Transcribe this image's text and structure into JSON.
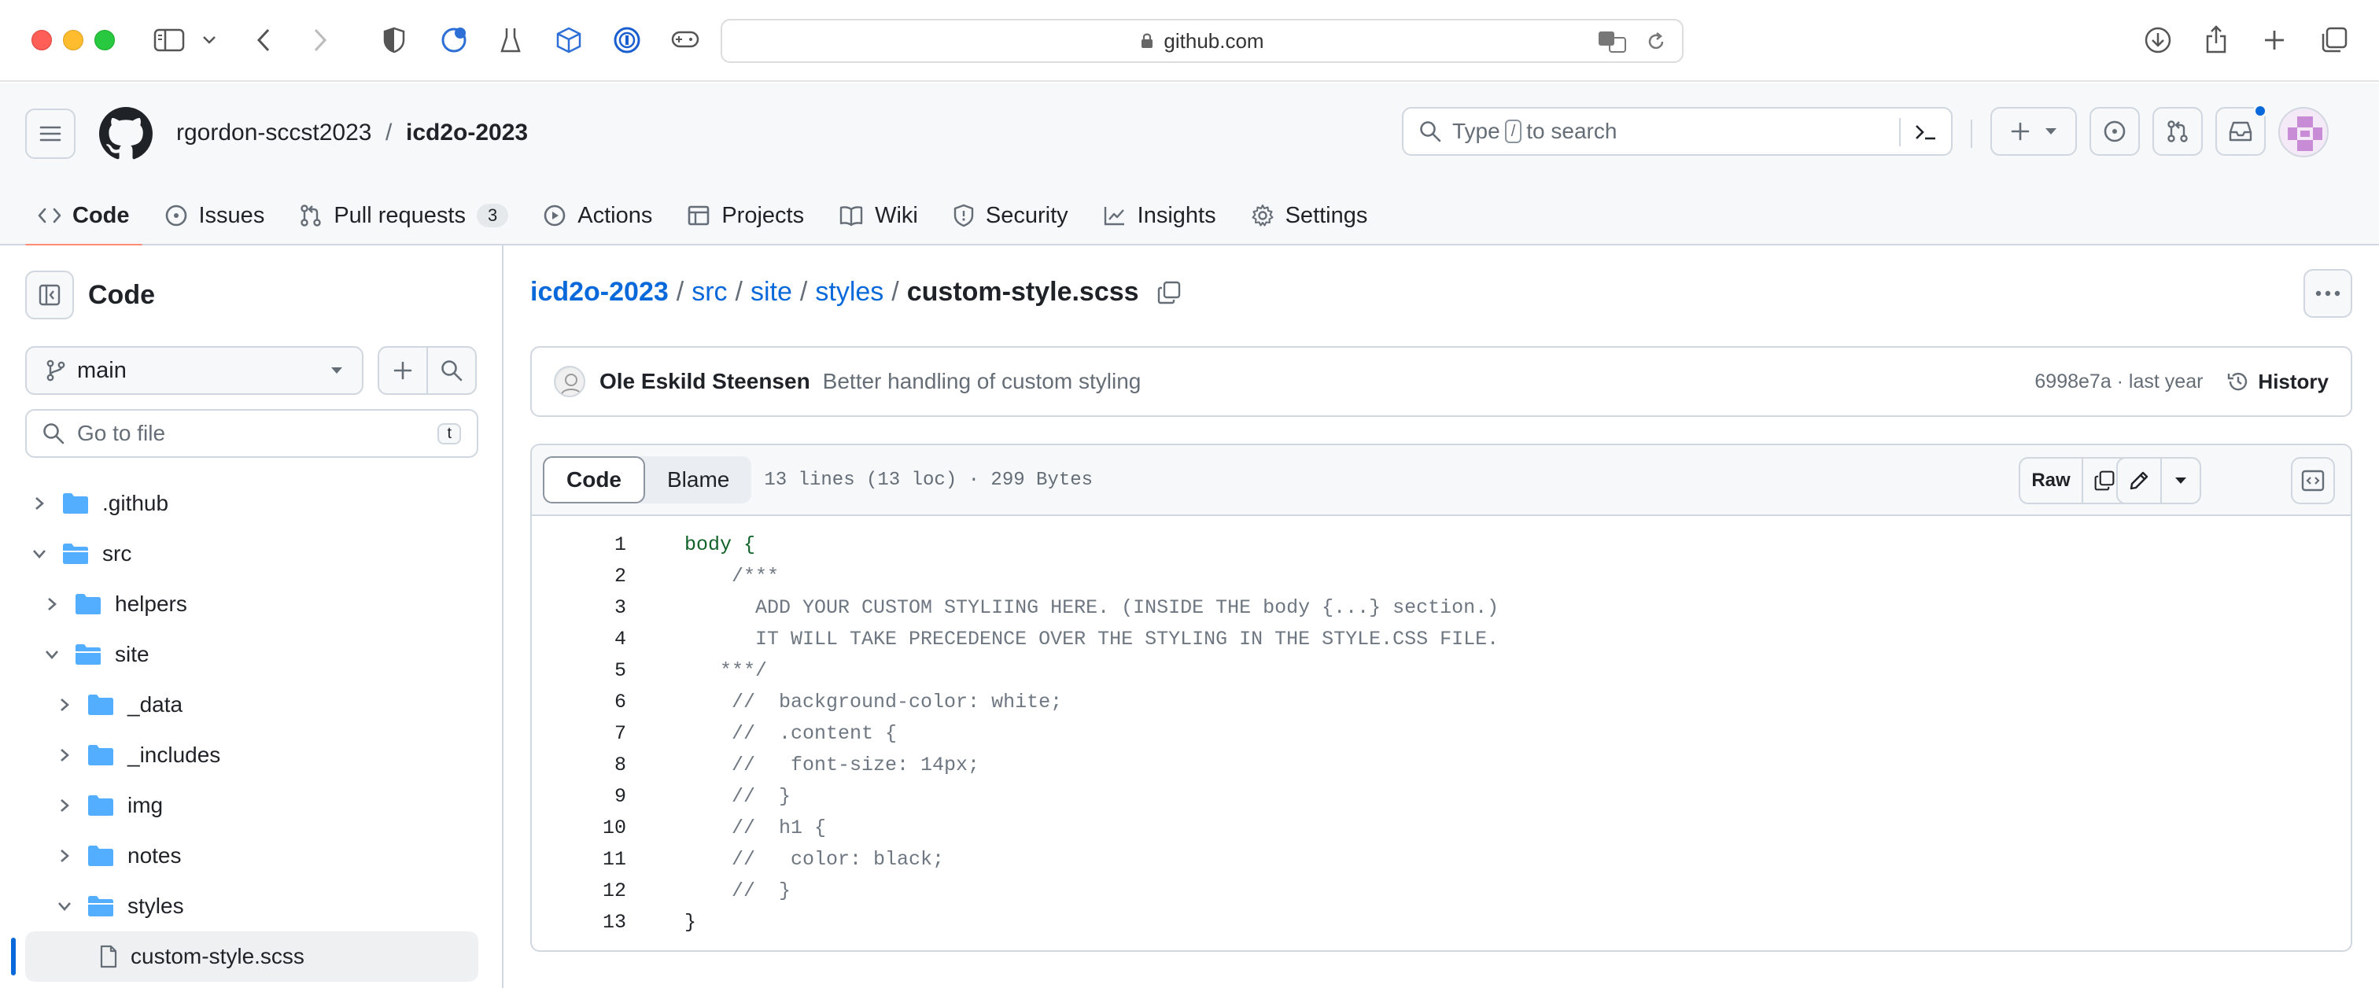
{
  "browser": {
    "url": "github.com"
  },
  "header": {
    "owner": "rgordon-sccst2023",
    "separator": "/",
    "repo": "icd2o-2023",
    "search_prefix": "Type",
    "search_key": "/",
    "search_suffix": "to search"
  },
  "repo_nav": {
    "tabs": [
      {
        "label": "Code",
        "icon": "code-icon",
        "active": true
      },
      {
        "label": "Issues",
        "icon": "issue-icon"
      },
      {
        "label": "Pull requests",
        "icon": "pull-request-icon",
        "count": "3"
      },
      {
        "label": "Actions",
        "icon": "play-icon"
      },
      {
        "label": "Projects",
        "icon": "table-icon"
      },
      {
        "label": "Wiki",
        "icon": "book-icon"
      },
      {
        "label": "Security",
        "icon": "shield-icon"
      },
      {
        "label": "Insights",
        "icon": "graph-icon"
      },
      {
        "label": "Settings",
        "icon": "gear-icon"
      }
    ]
  },
  "sidebar": {
    "title": "Code",
    "branch": "main",
    "goto_placeholder": "Go to file",
    "goto_key": "t",
    "tree": [
      {
        "name": ".github",
        "expanded": false,
        "depth": 0
      },
      {
        "name": "src",
        "expanded": true,
        "depth": 0
      },
      {
        "name": "helpers",
        "expanded": false,
        "depth": 1
      },
      {
        "name": "site",
        "expanded": true,
        "depth": 1
      },
      {
        "name": "_data",
        "expanded": false,
        "depth": 2
      },
      {
        "name": "_includes",
        "expanded": false,
        "depth": 2
      },
      {
        "name": "img",
        "expanded": false,
        "depth": 2
      },
      {
        "name": "notes",
        "expanded": false,
        "depth": 2
      },
      {
        "name": "styles",
        "expanded": true,
        "depth": 2
      },
      {
        "name": "custom-style.scss",
        "file": true,
        "selected": true,
        "depth": 3
      }
    ]
  },
  "breadcrumb": {
    "parts": [
      "icd2o-2023",
      "src",
      "site",
      "styles"
    ],
    "sep": "/",
    "current": "custom-style.scss"
  },
  "commit": {
    "author": "Ole Eskild Steensen",
    "message": "Better handling of custom styling",
    "meta": "6998e7a · last year",
    "history_label": "History"
  },
  "file": {
    "code_tab": "Code",
    "blame_tab": "Blame",
    "info": "13 lines (13 loc) · 299 Bytes",
    "raw_label": "Raw",
    "lines": [
      {
        "n": "1",
        "text": "body {",
        "kind": "sel"
      },
      {
        "n": "2",
        "text": "    /***",
        "kind": "comment"
      },
      {
        "n": "3",
        "text": "      ADD YOUR CUSTOM STYLIING HERE. (INSIDE THE body {...} section.)",
        "kind": "comment"
      },
      {
        "n": "4",
        "text": "      IT WILL TAKE PRECEDENCE OVER THE STYLING IN THE STYLE.CSS FILE.",
        "kind": "comment"
      },
      {
        "n": "5",
        "text": "   ***/",
        "kind": "comment"
      },
      {
        "n": "6",
        "text": "    //  background-color: white;",
        "kind": "comment"
      },
      {
        "n": "7",
        "text": "    //  .content {",
        "kind": "comment"
      },
      {
        "n": "8",
        "text": "    //   font-size: 14px;",
        "kind": "comment"
      },
      {
        "n": "9",
        "text": "    //  }",
        "kind": "comment"
      },
      {
        "n": "10",
        "text": "    //  h1 {",
        "kind": "comment"
      },
      {
        "n": "11",
        "text": "    //   color: black;",
        "kind": "comment"
      },
      {
        "n": "12",
        "text": "    //  }",
        "kind": "comment"
      },
      {
        "n": "13",
        "text": "}",
        "kind": "plain"
      }
    ]
  },
  "colors": {
    "link": "#0969da",
    "active_tab_underline": "#fd8c73",
    "folder": "#54aeff"
  }
}
